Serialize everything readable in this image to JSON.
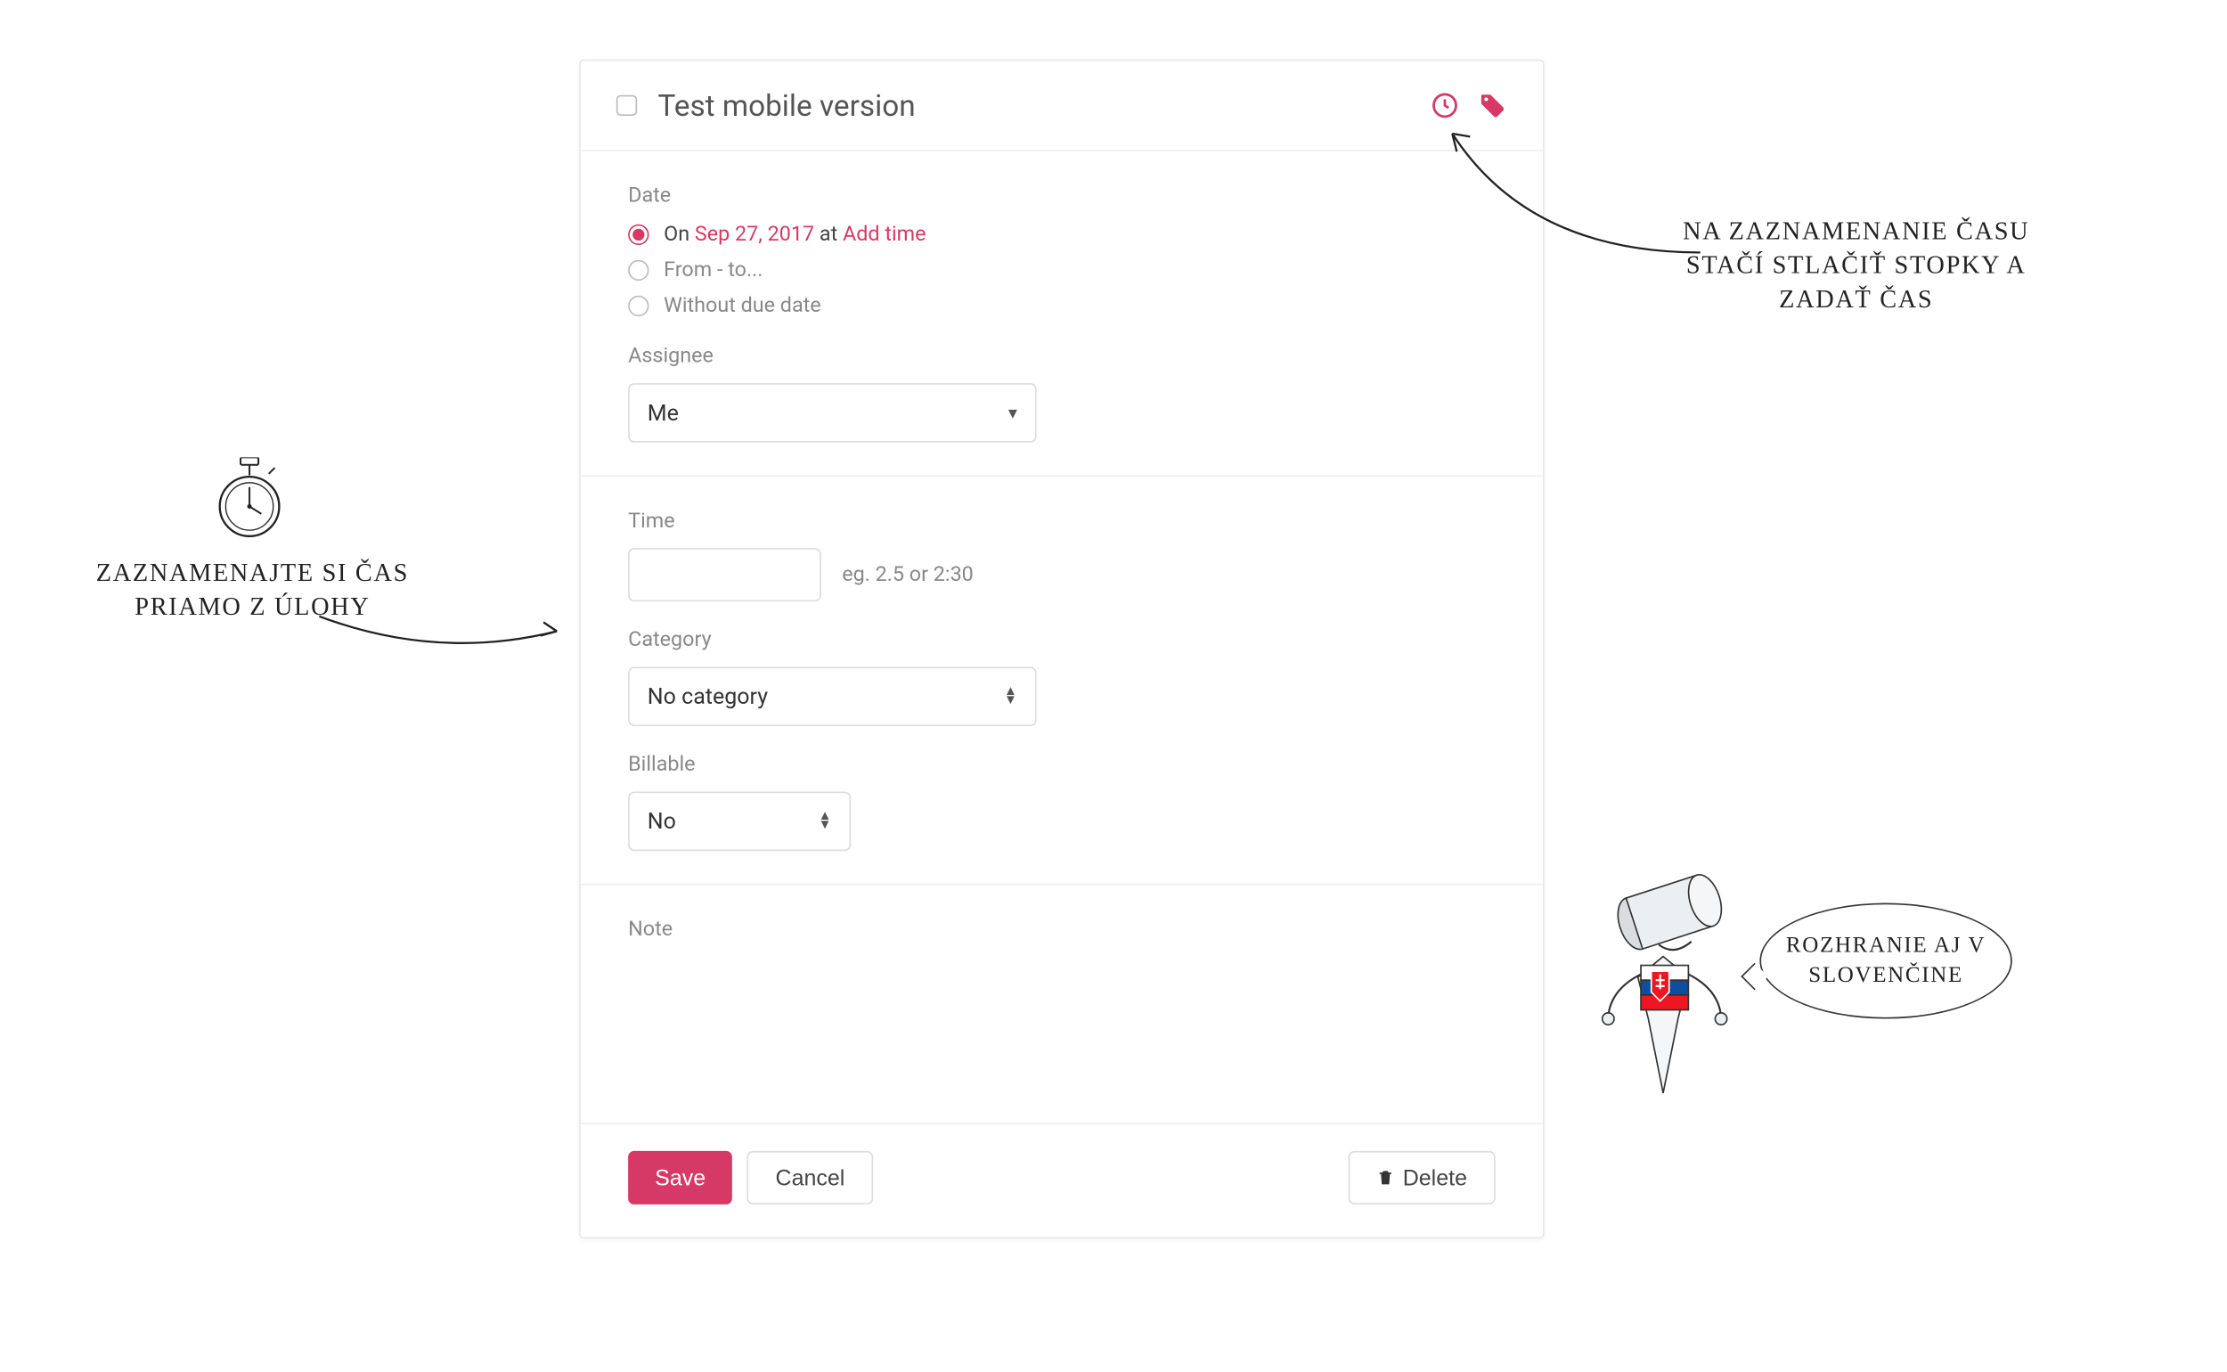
{
  "task": {
    "title": "Test mobile version"
  },
  "date": {
    "label": "Date",
    "on_prefix": "On ",
    "on_date": "Sep 27, 2017",
    "on_middle": " at ",
    "on_action": "Add time",
    "from_to": "From - to...",
    "without": "Without due date"
  },
  "assignee": {
    "label": "Assignee",
    "value": "Me"
  },
  "time": {
    "label": "Time",
    "hint": "eg. 2.5 or 2:30"
  },
  "category": {
    "label": "Category",
    "value": "No category"
  },
  "billable": {
    "label": "Billable",
    "value": "No"
  },
  "note": {
    "label": "Note"
  },
  "buttons": {
    "save": "Save",
    "cancel": "Cancel",
    "delete": "Delete"
  },
  "annotations": {
    "left": "ZAZNAMENAJTE SI ČAS PRIAMO Z ÚLOHY",
    "right": "NA ZAZNAMENANIE ČASU STAČÍ STLAČIŤ STOPKY A ZADAŤ ČAS",
    "bubble": "ROZHRANIE AJ V SLOVENČINE"
  },
  "colors": {
    "accent": "#d63965"
  }
}
